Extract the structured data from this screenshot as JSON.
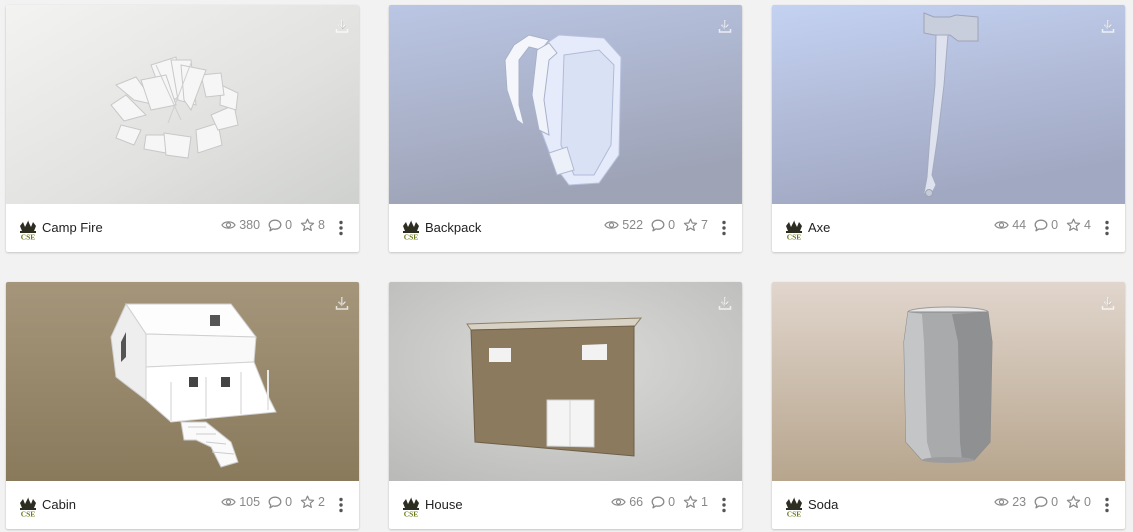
{
  "models": [
    {
      "title": "Camp Fire",
      "views": "380",
      "comments": "0",
      "likes": "8"
    },
    {
      "title": "Backpack",
      "views": "522",
      "comments": "0",
      "likes": "7"
    },
    {
      "title": "Axe",
      "views": "44",
      "comments": "0",
      "likes": "4"
    },
    {
      "title": "Cabin",
      "views": "105",
      "comments": "0",
      "likes": "2"
    },
    {
      "title": "House",
      "views": "66",
      "comments": "0",
      "likes": "1"
    },
    {
      "title": "Soda",
      "views": "23",
      "comments": "0",
      "likes": "0"
    }
  ],
  "author_avatar_text": "CSE",
  "colors": {
    "page_background": "#f2f2f2",
    "stat_text": "#888888",
    "title_text": "#222222"
  },
  "icons": {
    "download": "download-icon",
    "views": "eye-icon",
    "comments": "comment-icon",
    "likes": "star-icon",
    "menu": "more-vertical-icon"
  }
}
